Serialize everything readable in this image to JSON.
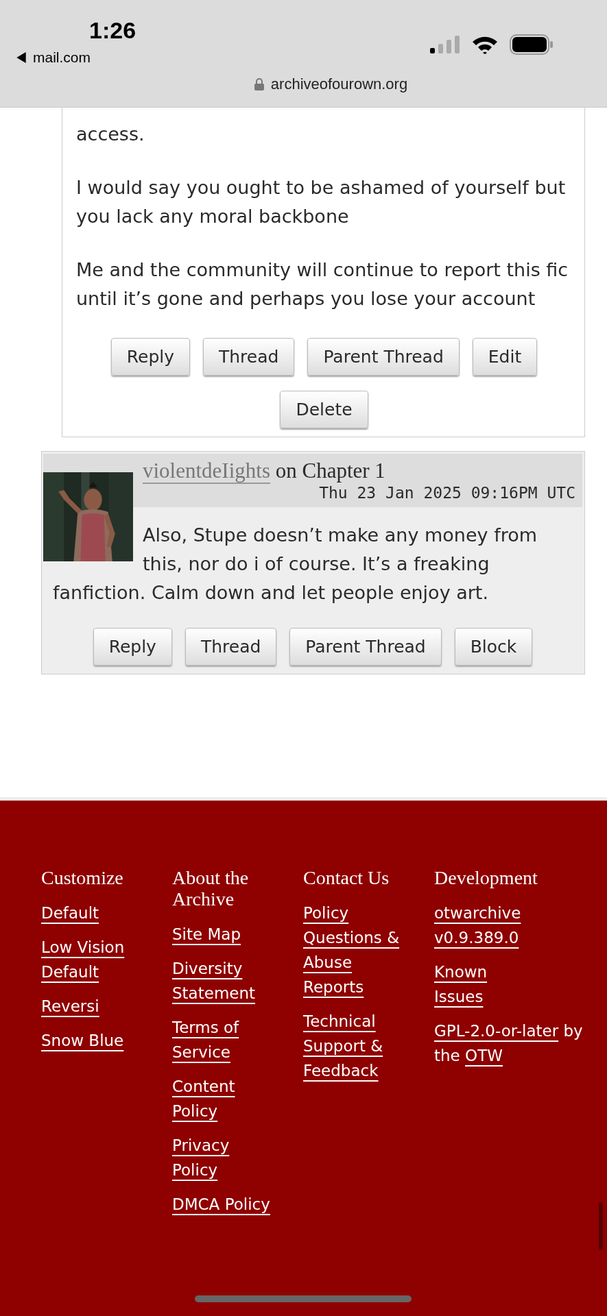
{
  "status_bar": {
    "time": "1:26",
    "back_app": "mail.com"
  },
  "address_bar": {
    "url": "archiveofourown.org"
  },
  "comments": [
    {
      "kind": "own",
      "paragraphs": [
        "access.",
        "I would say you ought to be ashamed of yourself but you lack any moral backbone",
        "Me and the community will continue to report this fic until it’s gone and perhaps you lose your account"
      ],
      "actions": [
        "Reply",
        "Thread",
        "Parent Thread",
        "Edit",
        "Delete"
      ]
    },
    {
      "kind": "other",
      "avatar": {
        "kind": "picture"
      },
      "author": "violentdeIights",
      "chapter": "on Chapter 1",
      "date": "Thu 23 Jan 2025 09:16PM UTC",
      "paragraphs": [
        "Also, Stupe doesn’t make any money from this, nor do i of course. It’s a freaking fanfiction. Calm down and let people enjoy art."
      ],
      "actions": [
        "Reply",
        "Thread",
        "Parent Thread",
        "Block"
      ]
    }
  ],
  "footer": {
    "columns": [
      {
        "heading": "Customize",
        "items": [
          {
            "kind": "link",
            "text": "Default"
          },
          {
            "kind": "link",
            "text": "Low Vision Default"
          },
          {
            "kind": "link",
            "text": "Reversi"
          },
          {
            "kind": "link",
            "text": "Snow Blue"
          }
        ]
      },
      {
        "heading": "About the Archive",
        "items": [
          {
            "kind": "link",
            "text": "Site Map"
          },
          {
            "kind": "link",
            "text": "Diversity Statement"
          },
          {
            "kind": "link",
            "text": "Terms of Service"
          },
          {
            "kind": "link",
            "text": "Content Policy"
          },
          {
            "kind": "link",
            "text": "Privacy Policy"
          },
          {
            "kind": "link",
            "text": "DMCA Policy"
          }
        ]
      },
      {
        "heading": "Contact Us",
        "items": [
          {
            "kind": "link",
            "text": "Policy Questions & Abuse Reports"
          },
          {
            "kind": "link",
            "text": "Technical Support & Feedback"
          }
        ]
      },
      {
        "heading": "Development",
        "items": [
          {
            "kind": "link",
            "text": "otwarchive v0.9.389.0"
          },
          {
            "kind": "link",
            "text": "Known Issues"
          },
          {
            "kind": "credit",
            "segments": [
              {
                "text": "GPL-2.0-or-later",
                "link": true
              },
              {
                "text": "by",
                "link": false
              },
              {
                "text": "the",
                "link": false
              },
              {
                "text": "OTW",
                "link": true
              }
            ]
          }
        ]
      }
    ]
  }
}
